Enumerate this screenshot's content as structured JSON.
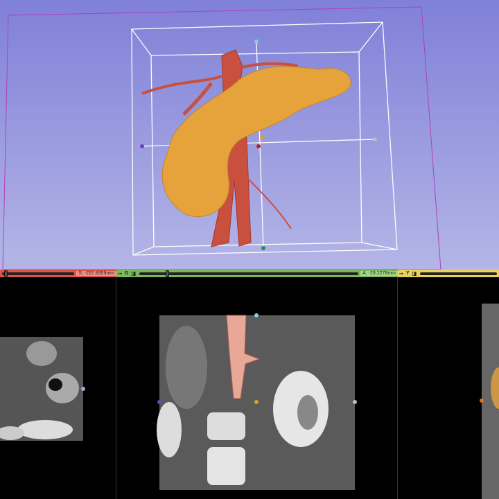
{
  "slice_controls": {
    "red": {
      "offset_label": "S: -257.8359mm"
    },
    "green": {
      "pin": "⊸",
      "letter": "G",
      "link": "◨",
      "offset_label": "A: -29.2278mm"
    },
    "yellow": {
      "pin": "⊸",
      "letter": "Y",
      "link": "◨"
    }
  },
  "colors": {
    "pancreas": "#e6a33c",
    "vessels": "#c9503e",
    "background_top": "#7f80d8",
    "background_bottom": "#b4b5e6"
  }
}
